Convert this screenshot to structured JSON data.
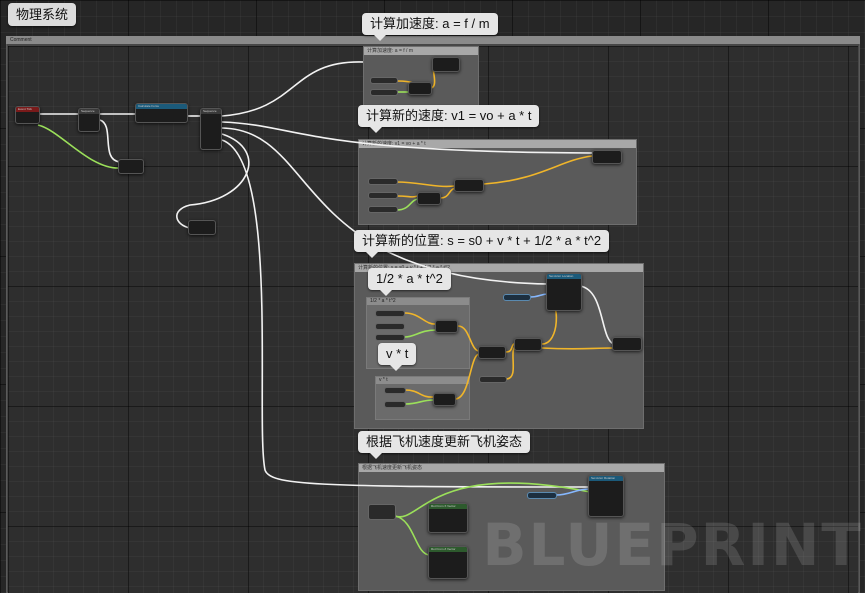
{
  "tab": {
    "title": "物理系统"
  },
  "outer_comment": {
    "title": "Comment"
  },
  "bubbles": {
    "acceleration": "计算加速度: a = f / m",
    "velocity": "计算新的速度: v1 = vo + a * t",
    "position": "计算新的位置: s = s0 + v * t + 1/2 * a * t^2",
    "half_term": "1/2 * a * t^2",
    "vt_term": "v * t",
    "attitude": "根据飞机速度更新飞机姿态"
  },
  "boxes": {
    "acceleration": "计算加速度: a = f / m",
    "velocity": "计算新的速度: v1 = vo + a * t",
    "position": "计算新的位置: s = s0 + v * t + 1/2 * a * t^2",
    "half_term": "1/2 * a * t^2",
    "vt_term": "v * t",
    "attitude": "根据飞机速度更新飞机姿态"
  },
  "nodes": {
    "event_tick": "Event Tick",
    "sequence": "Sequence",
    "calculate_force": "Calculate Force",
    "sequence2": "Sequence",
    "set_actor_location": "Set Actor Location",
    "set_actor_rotation": "Set Actor Rotation",
    "rot_from_x": "Rot From X Vector",
    "rot_from_z": "Rot From Z Vector"
  },
  "watermark": "BLUEPRINT",
  "colors": {
    "exec_wire": "#f2f2f2",
    "vector_wire": "#f0b52a",
    "float_wire": "#9be05a",
    "rotator_wire": "#86b8ff",
    "comment_bubble": "#e6e6e6"
  }
}
